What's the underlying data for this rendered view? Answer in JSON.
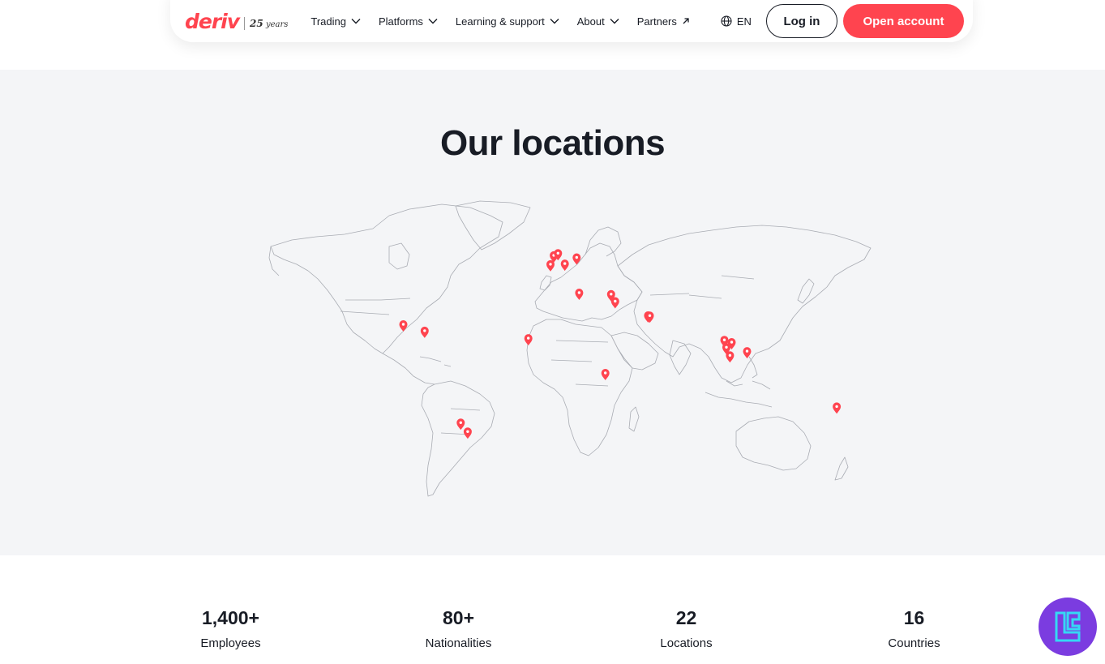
{
  "header": {
    "logo_word": "deriv",
    "logo_years_num": "25",
    "logo_years_text": "years",
    "menu": [
      {
        "label": "Trading",
        "icon": "chevron-down-icon"
      },
      {
        "label": "Platforms",
        "icon": "chevron-down-icon"
      },
      {
        "label": "Learning & support",
        "icon": "chevron-down-icon"
      },
      {
        "label": "About",
        "icon": "chevron-down-icon"
      },
      {
        "label": "Partners",
        "icon": "external-arrow-icon"
      }
    ],
    "language": "EN",
    "login_label": "Log in",
    "open_account_label": "Open account"
  },
  "locations": {
    "title": "Our locations",
    "marker_color": "#ff444f",
    "markers": [
      {
        "lon": -89.6,
        "lat": 21.0
      },
      {
        "lon": -77.0,
        "lat": 18.0
      },
      {
        "lon": -15.6,
        "lat": 14.5
      },
      {
        "lon": -55.6,
        "lat": -25.3
      },
      {
        "lon": -51.5,
        "lat": -29.5
      },
      {
        "lon": -2.5,
        "lat": 49.3
      },
      {
        "lon": -0.5,
        "lat": 53.5
      },
      {
        "lon": 2.0,
        "lat": 54.5
      },
      {
        "lon": 6.0,
        "lat": 49.6
      },
      {
        "lon": 13.0,
        "lat": 52.5
      },
      {
        "lon": 14.5,
        "lat": 35.9
      },
      {
        "lon": 33.4,
        "lat": 35.2
      },
      {
        "lon": 35.8,
        "lat": 31.9
      },
      {
        "lon": 55.3,
        "lat": 25.2
      },
      {
        "lon": 56.3,
        "lat": 25.1
      },
      {
        "lon": 30.0,
        "lat": -1.9
      },
      {
        "lon": 100.5,
        "lat": 13.7
      },
      {
        "lon": 101.7,
        "lat": 10.2
      },
      {
        "lon": 104.8,
        "lat": 12.6
      },
      {
        "lon": 103.8,
        "lat": 6.4
      },
      {
        "lon": 113.9,
        "lat": 8.4
      },
      {
        "lon": 167.0,
        "lat": -17.7
      }
    ]
  },
  "stats": [
    {
      "value": "1,400+",
      "label": "Employees"
    },
    {
      "value": "80+",
      "label": "Nationalities"
    },
    {
      "value": "22",
      "label": "Locations"
    },
    {
      "value": "16",
      "label": "Countries"
    }
  ],
  "colors": {
    "accent": "#ff444f",
    "text": "#181c25",
    "section_bg": "#f4f5f7",
    "badge_bg": "#7b3ce0"
  }
}
